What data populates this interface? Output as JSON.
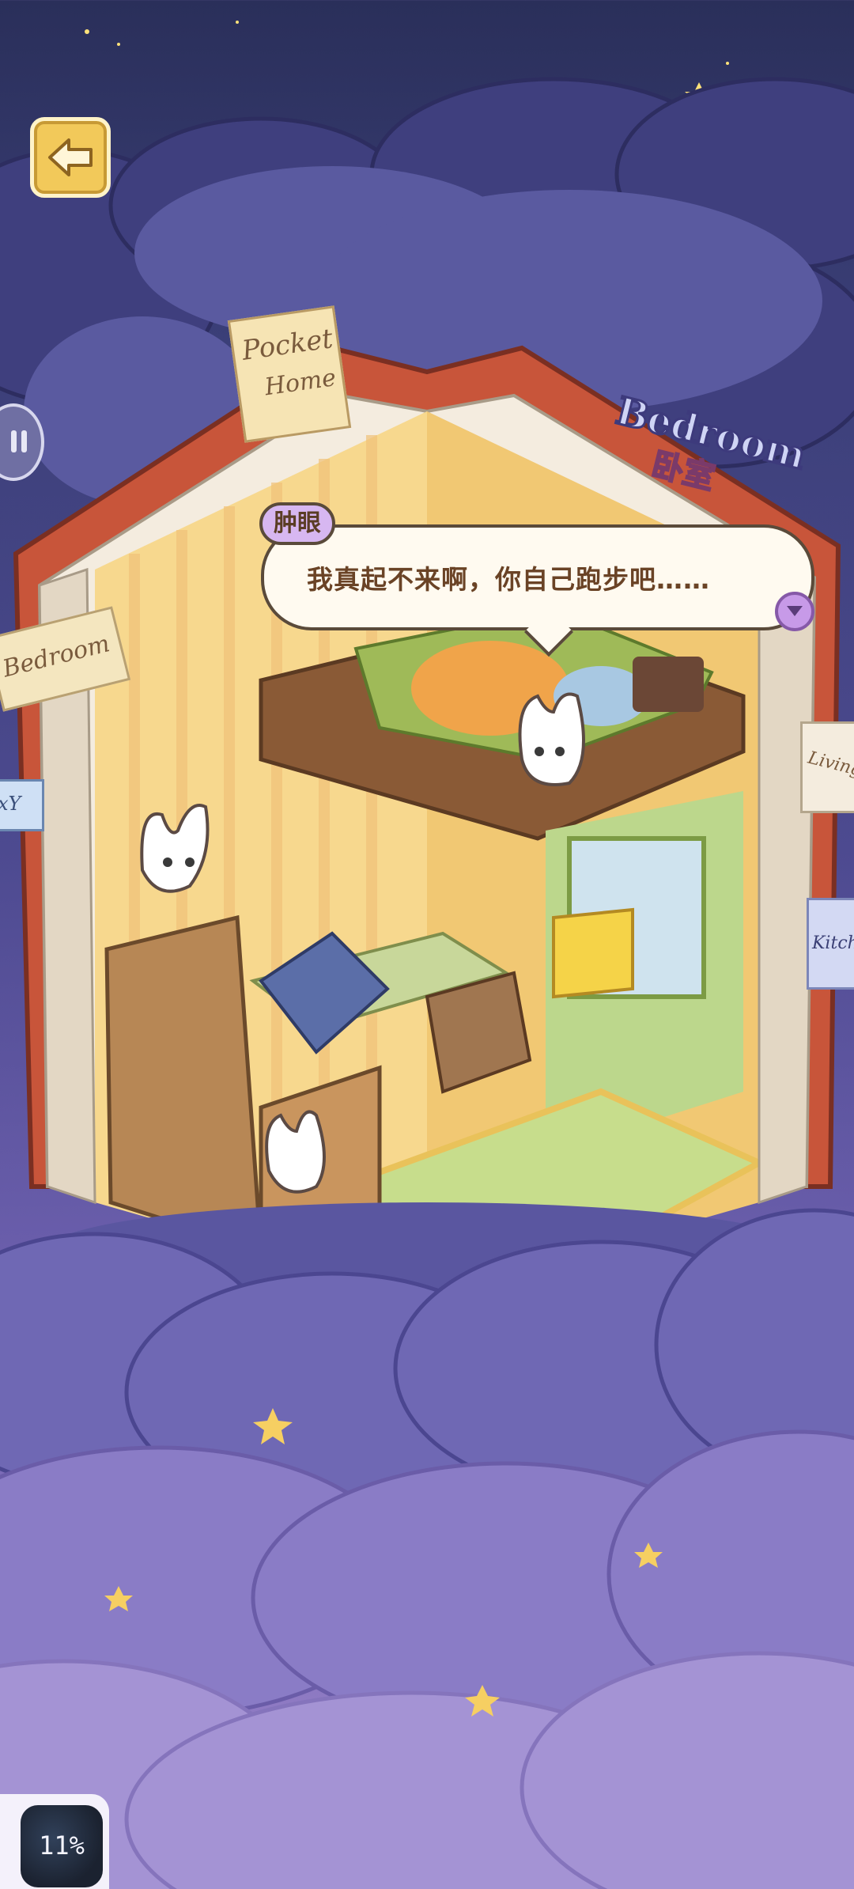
{
  "back_button": {
    "label": ""
  },
  "room_label_book": [
    "Pocket",
    "Home"
  ],
  "room_label_main": "Bedroom",
  "room_label_main_sub": "卧室",
  "left_flag": "Bedroom",
  "left_flag_partial": "xY",
  "right_flags": [
    "Livingr",
    "Kitch"
  ],
  "dialogue": {
    "speaker": "肿眼",
    "text": "我真起不来啊，你自己跑步吧……"
  },
  "progress": {
    "value": "11%"
  }
}
